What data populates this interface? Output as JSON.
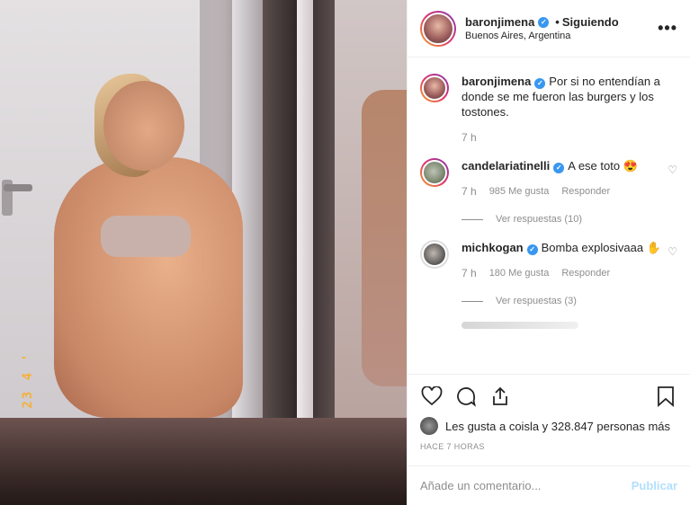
{
  "photo": {
    "date_stamp": "23 4 '",
    "alt": "photo"
  },
  "header": {
    "username": "baronjimena",
    "separator": "•",
    "follow_status": "Siguiendo",
    "location": "Buenos Aires, Argentina",
    "more_icon": "more-icon",
    "more_label": "•••"
  },
  "caption": {
    "username": "baronjimena",
    "text": "Por si no entendían a donde se me fueron las burgers y los tostones.",
    "time": "7 h"
  },
  "comments": [
    {
      "username": "candelariatinelli",
      "text": "A ese toto 😍",
      "time": "7 h",
      "likes": "985 Me gusta",
      "reply": "Responder",
      "view_replies": "Ver respuestas (10)"
    },
    {
      "username": "michkogan",
      "text": "Bomba explosivaaa ✋",
      "time": "7 h",
      "likes": "180 Me gusta",
      "reply": "Responder",
      "view_replies": "Ver respuestas (3)"
    }
  ],
  "likes": {
    "text": "Les gusta a coisla y 328.847 personas más"
  },
  "time_ago": "HACE 7 HORAS",
  "composer": {
    "placeholder": "Añade un comentario...",
    "post_label": "Publicar"
  },
  "colors": {
    "verified": "#3897f0",
    "muted": "#8e8e8e",
    "post_disabled": "#b2dffc",
    "stamp": "#f4b13b"
  }
}
